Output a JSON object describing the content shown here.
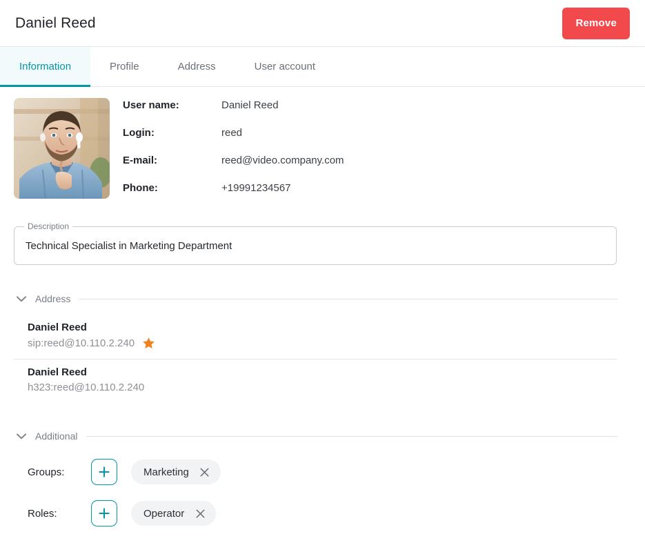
{
  "header": {
    "title": "Daniel Reed",
    "remove_label": "Remove"
  },
  "tabs": [
    {
      "label": "Information",
      "active": true
    },
    {
      "label": "Profile",
      "active": false
    },
    {
      "label": "Address",
      "active": false
    },
    {
      "label": "User account",
      "active": false
    }
  ],
  "avatar": {
    "icon": "user-photo",
    "alt": "Portrait photo of a bearded man wearing earbuds and a light blue shirt"
  },
  "info_fields": [
    {
      "label": "User name:",
      "value": "Daniel Reed"
    },
    {
      "label": "Login:",
      "value": "reed"
    },
    {
      "label": "E-mail:",
      "value": "reed@video.company.com"
    },
    {
      "label": "Phone:",
      "value": "+19991234567"
    }
  ],
  "description": {
    "legend": "Description",
    "value": "Technical Specialist in Marketing Department",
    "placeholder": "Description"
  },
  "address_section": {
    "title": "Address",
    "chevron_icon": "chevron-down-icon",
    "items": [
      {
        "name": "Daniel Reed",
        "uri": "sip:reed@10.110.2.240",
        "favorite": true,
        "favorite_icon": "star-icon"
      },
      {
        "name": "Daniel Reed",
        "uri": "h323:reed@10.110.2.240",
        "favorite": false,
        "favorite_icon": "star-icon"
      }
    ]
  },
  "additional_section": {
    "title": "Additional",
    "chevron_icon": "chevron-down-icon",
    "rows": [
      {
        "label": "Groups:",
        "add_icon": "plus-icon",
        "chips": [
          {
            "label": "Marketing",
            "remove_icon": "close-icon"
          }
        ]
      },
      {
        "label": "Roles:",
        "add_icon": "plus-icon",
        "chips": [
          {
            "label": "Operator",
            "remove_icon": "close-icon"
          }
        ]
      }
    ]
  },
  "colors": {
    "accent_teal": "#0295a8",
    "danger_red": "#f24a4c",
    "star_orange": "#f08020",
    "active_tab_bg": "#f3fafc",
    "chip_bg": "#f2f3f4",
    "muted_text": "#8b9197",
    "border": "#e4e6e8"
  }
}
